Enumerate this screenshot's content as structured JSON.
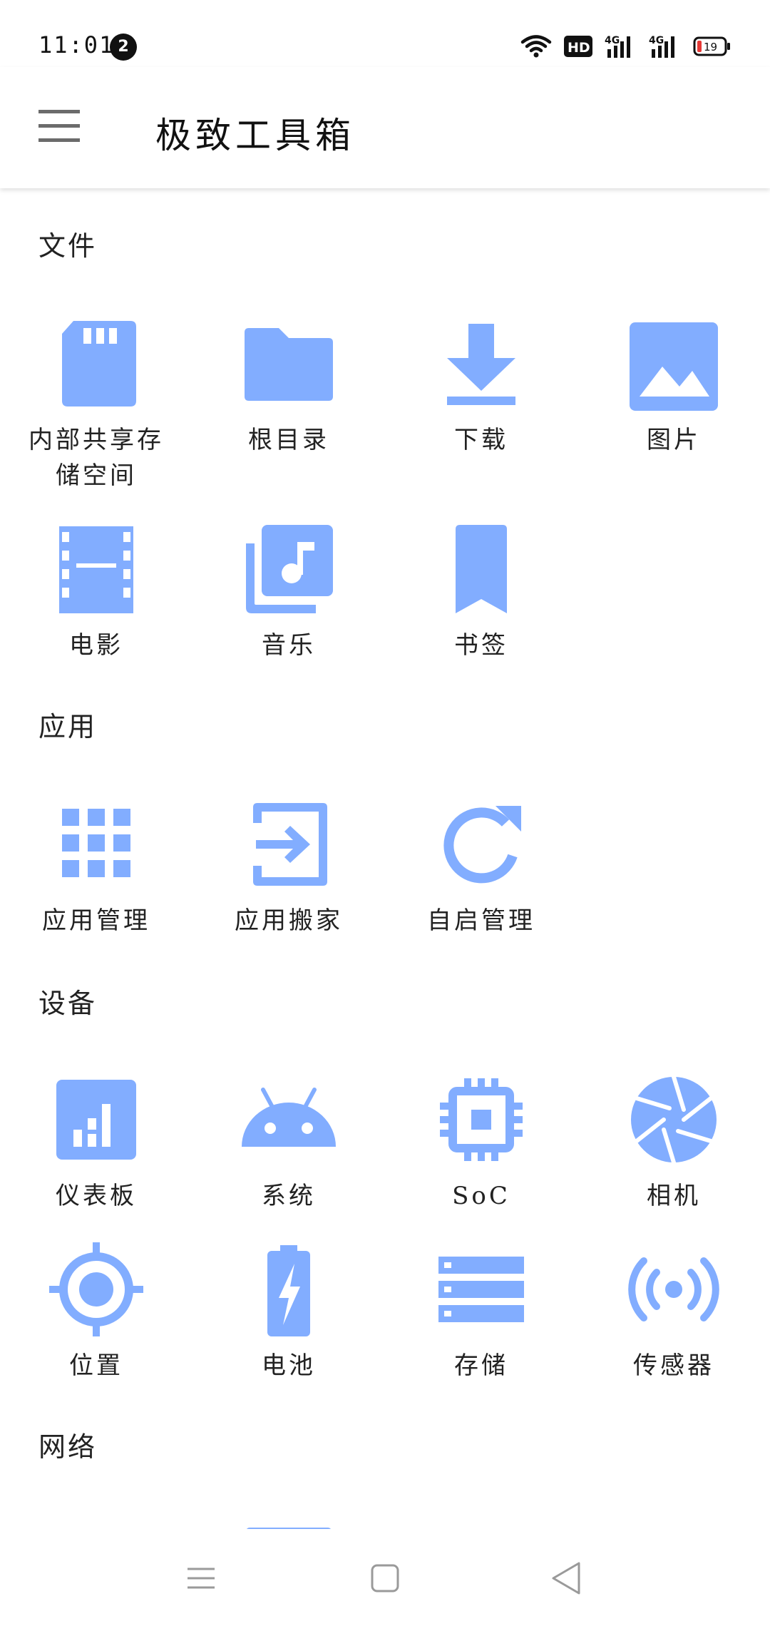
{
  "status_bar": {
    "time": "11:01",
    "notification_count": "2",
    "battery_level": "19",
    "network_label_1": "4G",
    "network_label_2": "4G",
    "hd_label": "HD"
  },
  "app_bar": {
    "title": "极致工具箱",
    "menu_icon": "menu-icon"
  },
  "accent_color": "#82adff",
  "sections": {
    "files": {
      "title": "文件",
      "items": [
        {
          "label": "内部共享存储空间",
          "icon": "sd-card-icon"
        },
        {
          "label": "根目录",
          "icon": "folder-icon"
        },
        {
          "label": "下载",
          "icon": "download-icon"
        },
        {
          "label": "图片",
          "icon": "image-icon"
        },
        {
          "label": "电影",
          "icon": "movie-icon"
        },
        {
          "label": "音乐",
          "icon": "music-library-icon"
        },
        {
          "label": "书签",
          "icon": "bookmark-icon"
        }
      ]
    },
    "apps": {
      "title": "应用",
      "items": [
        {
          "label": "应用管理",
          "icon": "apps-grid-icon"
        },
        {
          "label": "应用搬家",
          "icon": "app-move-icon"
        },
        {
          "label": "自启管理",
          "icon": "refresh-icon"
        }
      ]
    },
    "device": {
      "title": "设备",
      "items": [
        {
          "label": "仪表板",
          "icon": "dashboard-icon"
        },
        {
          "label": "系统",
          "icon": "android-icon"
        },
        {
          "label": "SoC",
          "icon": "chip-icon"
        },
        {
          "label": "相机",
          "icon": "camera-aperture-icon"
        },
        {
          "label": "位置",
          "icon": "location-icon"
        },
        {
          "label": "电池",
          "icon": "battery-charging-icon"
        },
        {
          "label": "存储",
          "icon": "storage-icon"
        },
        {
          "label": "传感器",
          "icon": "sensor-icon"
        }
      ]
    },
    "network": {
      "title": "网络"
    }
  },
  "nav_bar": {
    "buttons": [
      "menu-nav-icon",
      "home-nav-icon",
      "back-nav-icon"
    ]
  }
}
